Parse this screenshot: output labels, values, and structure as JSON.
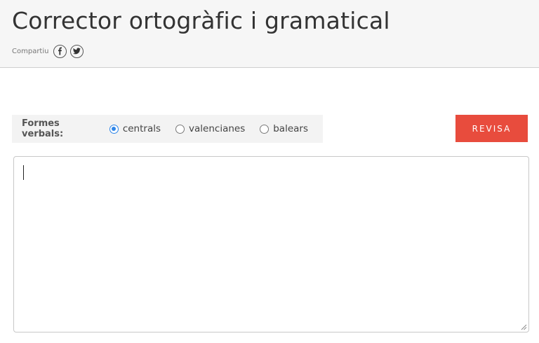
{
  "header": {
    "title": "Corrector ortogràfic i gramatical",
    "share_label": "Compartiu",
    "share_icons": [
      "facebook-icon",
      "twitter-icon"
    ]
  },
  "options": {
    "label": "Formes verbals:",
    "radios": [
      {
        "label": "centrals",
        "checked": true
      },
      {
        "label": "valencianes",
        "checked": false
      },
      {
        "label": "balears",
        "checked": false
      }
    ]
  },
  "actions": {
    "revisa_label": "REVISA"
  },
  "editor": {
    "value": ""
  },
  "colors": {
    "accent_button": "#e84c3d",
    "radio_selected": "#2f86e8",
    "header_bg": "#f6f6f6"
  }
}
